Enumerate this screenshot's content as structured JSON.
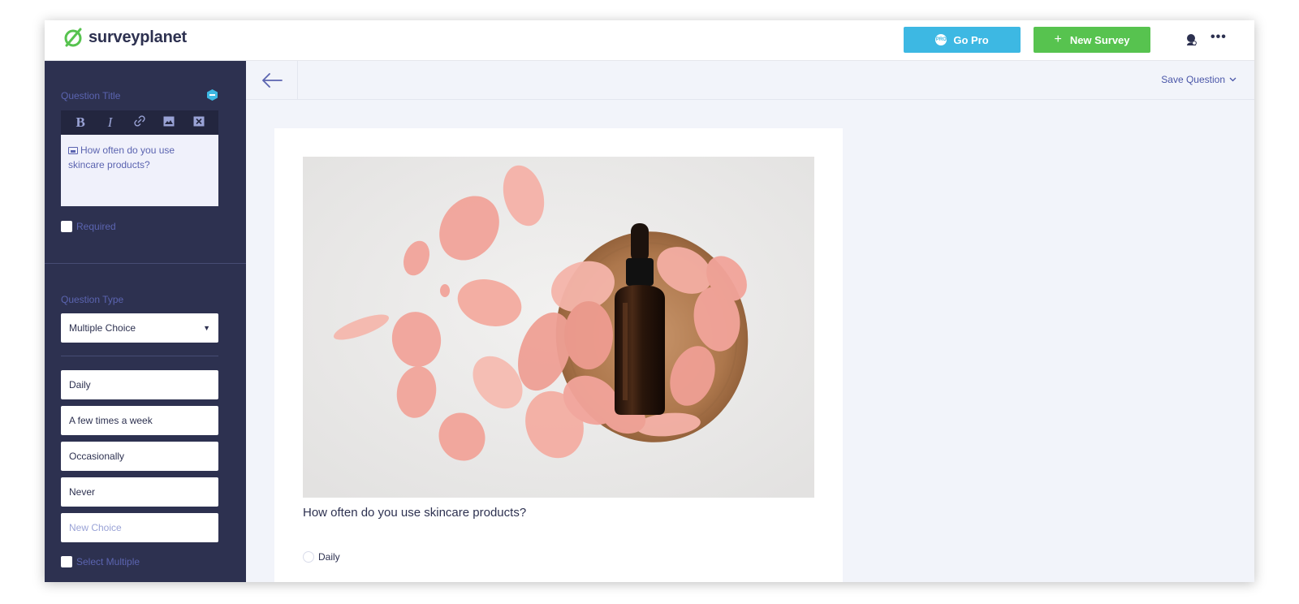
{
  "app": {
    "logo_text": "surveyplanet",
    "brand_color": "#57c34f"
  },
  "header": {
    "go_pro_label": "Go Pro",
    "new_survey_label": "New Survey",
    "pro_badge_text": "PRO"
  },
  "sidebar": {
    "question_title_label": "Question Title",
    "toolbar": {
      "bold": "B",
      "italic": "I",
      "link_icon": "link-icon",
      "image_icon": "image-icon",
      "clear_icon": "clear-icon"
    },
    "title_text": "How often do you use skincare products?",
    "required_label": "Required",
    "question_type_label": "Question Type",
    "question_type_value": "Multiple Choice",
    "choices": [
      "Daily",
      "A few times a week",
      "Occasionally",
      "Never"
    ],
    "new_choice_placeholder": "New Choice",
    "select_multiple_label": "Select Multiple"
  },
  "main": {
    "save_question_label": "Save Question",
    "question_text": "How often do you use skincare products?",
    "options": [
      "Daily"
    ]
  },
  "colors": {
    "sidebar_bg": "#2d3150",
    "go_pro": "#3db8e3",
    "new_survey": "#57c34f",
    "accent_text": "#5b64b0"
  }
}
